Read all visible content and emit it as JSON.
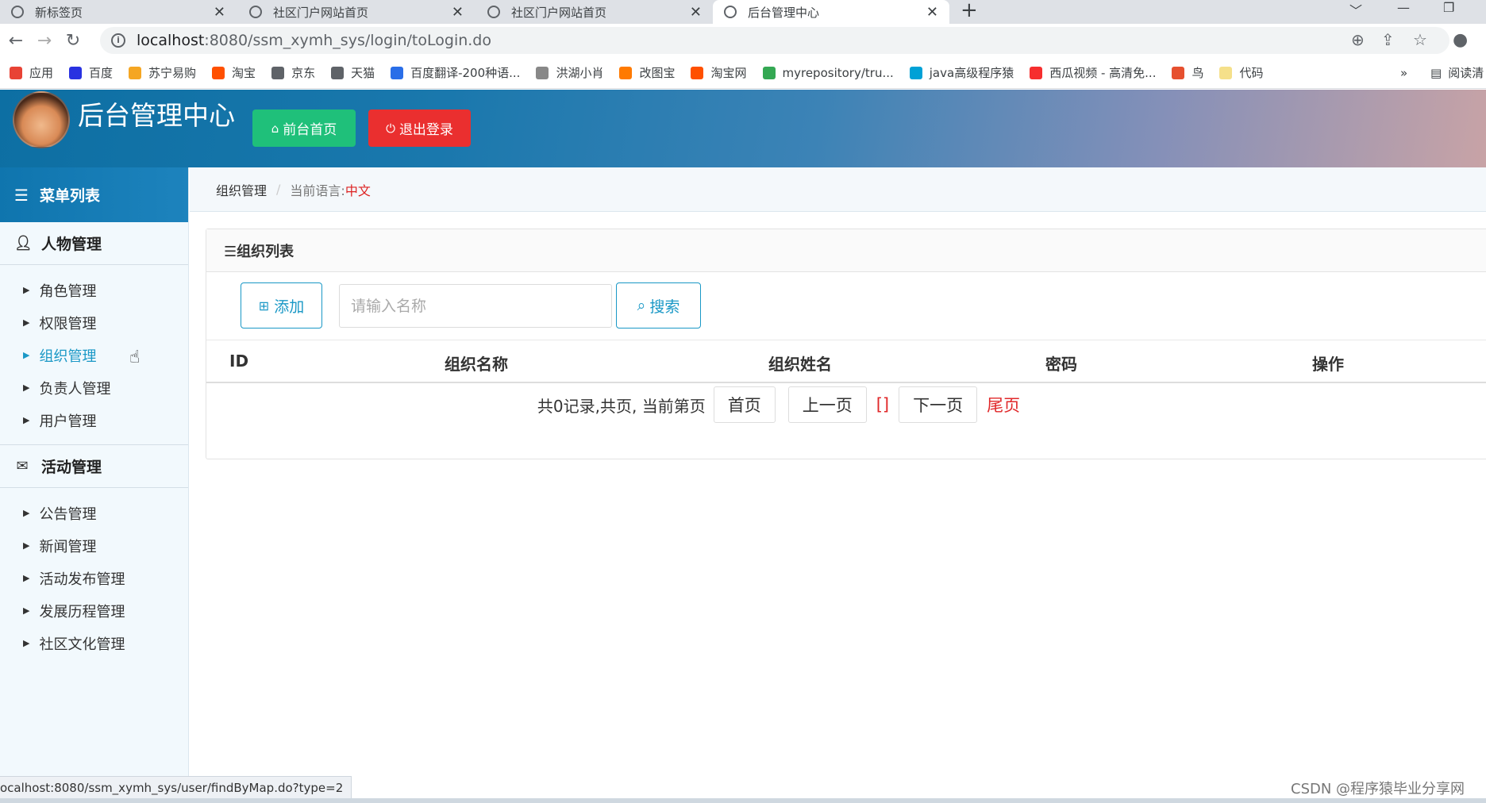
{
  "browser": {
    "tabs": [
      {
        "title": "新标签页",
        "active": false
      },
      {
        "title": "社区门户网站首页",
        "active": false
      },
      {
        "title": "社区门户网站首页",
        "active": false
      },
      {
        "title": "后台管理中心",
        "active": true
      }
    ],
    "new_tab": "+",
    "url_host": "localhost",
    "url_rest": ":8080/ssm_xymh_sys/login/toLogin.do",
    "bookmarks": [
      {
        "label": "应用",
        "color": "#e84335"
      },
      {
        "label": "百度",
        "color": "#2932e1"
      },
      {
        "label": "苏宁易购",
        "color": "#f5a623"
      },
      {
        "label": "淘宝",
        "color": "#ff5000"
      },
      {
        "label": "京东",
        "color": "#5f6368"
      },
      {
        "label": "天猫",
        "color": "#5f6368"
      },
      {
        "label": "百度翻译-200种语...",
        "color": "#2a6ee8"
      },
      {
        "label": "洪湖小肖",
        "color": "#888888"
      },
      {
        "label": "改图宝",
        "color": "#ff7a00"
      },
      {
        "label": "淘宝网",
        "color": "#ff5000"
      },
      {
        "label": "myrepository/tru...",
        "color": "#34a853"
      },
      {
        "label": "java高级程序猿",
        "color": "#00a1d6"
      },
      {
        "label": "西瓜视频 - 高清免...",
        "color": "#f62e2e"
      },
      {
        "label": "鸟",
        "color": "#e6502f"
      },
      {
        "label": "代码",
        "color": "#f5e08a"
      }
    ],
    "bookmarks_more": "»",
    "reading_list": "阅读清"
  },
  "header": {
    "title": "后台管理中心",
    "home_button": "前台首页",
    "logout_button": "退出登录"
  },
  "sidebar": {
    "heading": "菜单列表",
    "groups": [
      {
        "title": "人物管理",
        "items": [
          "角色管理",
          "权限管理",
          "组织管理",
          "负责人管理",
          "用户管理"
        ]
      },
      {
        "title": "活动管理",
        "items": [
          "公告管理",
          "新闻管理",
          "活动发布管理",
          "发展历程管理",
          "社区文化管理"
        ]
      }
    ],
    "active_item": "组织管理"
  },
  "breadcrumb": {
    "current": "组织管理",
    "lang_label": "当前语言:",
    "lang_value": "中文"
  },
  "panel": {
    "title": "☰组织列表",
    "add_button": "添加",
    "search_placeholder": "请输入名称",
    "search_button": "搜索",
    "columns": [
      "ID",
      "组织名称",
      "组织姓名",
      "密码",
      "操作"
    ],
    "rows": []
  },
  "pager": {
    "summary": "共0记录,共页, 当前第页",
    "first": "首页",
    "prev": "上一页",
    "pages": "[]",
    "next": "下一页",
    "last": "尾页"
  },
  "status_bar": {
    "url": "ocalhost:8080/ssm_xymh_sys/user/findByMap.do?type=2"
  },
  "watermark": "CSDN @程序猿毕业分享网"
}
